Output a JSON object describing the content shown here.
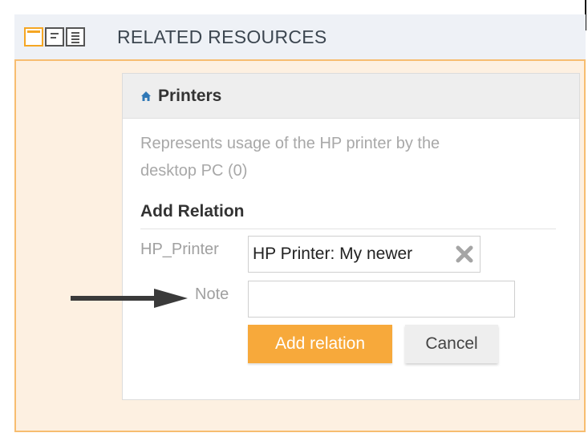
{
  "header": {
    "title": "RELATED RESOURCES",
    "view_icons": [
      "single-column-view-icon",
      "two-column-view-icon",
      "list-view-icon"
    ]
  },
  "card": {
    "title": "Printers",
    "title_icon": "home-icon",
    "description": "Represents usage of the HP printer by the desktop PC (0)"
  },
  "add_relation": {
    "heading": "Add Relation",
    "printer_label": "HP_Printer",
    "printer_value": "HP Printer: My newer",
    "note_label": "Note",
    "note_value": "",
    "add_button": "Add relation",
    "cancel_button": "Cancel"
  },
  "colors": {
    "accent": "#f7a93b",
    "panel_background": "#fdf0e1",
    "panel_border": "#f7bd70",
    "icon_blue": "#2f78b7"
  }
}
